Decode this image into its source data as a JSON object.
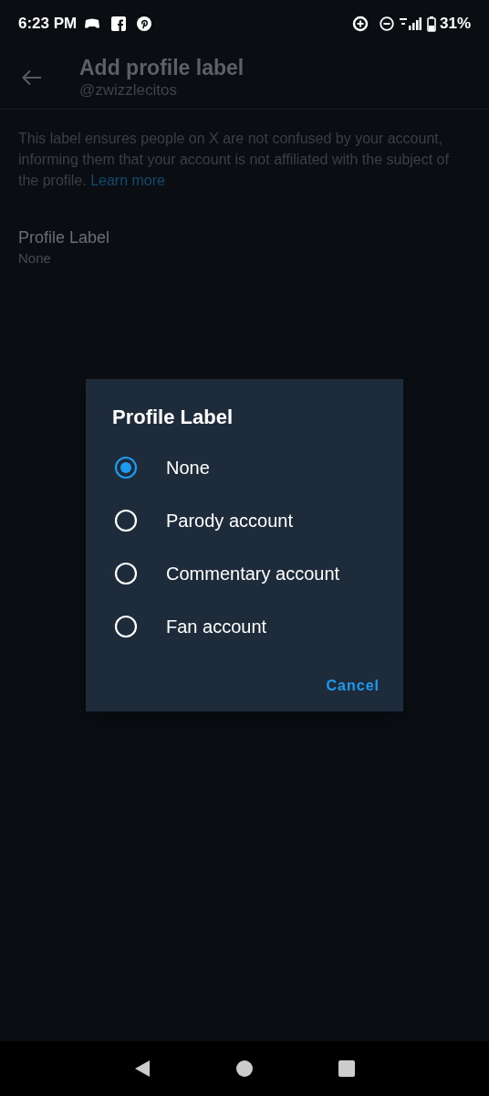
{
  "status_bar": {
    "time": "6:23 PM",
    "battery": "31%"
  },
  "header": {
    "title": "Add profile label",
    "handle": "@zwizzlecitos"
  },
  "description": {
    "text": "This label ensures people on X are not confused by your account, informing them that your account is not affiliated with the subject of the profile.",
    "link": "Learn more"
  },
  "setting": {
    "label": "Profile Label",
    "value": "None"
  },
  "dialog": {
    "title": "Profile Label",
    "options": [
      {
        "label": "None",
        "selected": true
      },
      {
        "label": "Parody account",
        "selected": false
      },
      {
        "label": "Commentary account",
        "selected": false
      },
      {
        "label": "Fan account",
        "selected": false
      }
    ],
    "button": "Cancel"
  }
}
